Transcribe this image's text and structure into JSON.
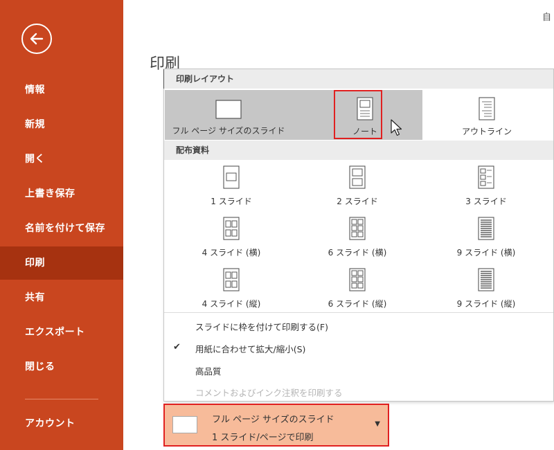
{
  "window": {
    "top_right_text": "自",
    "heading": "印刷"
  },
  "sidebar": {
    "items": [
      {
        "label": "情報"
      },
      {
        "label": "新規"
      },
      {
        "label": "開く"
      },
      {
        "label": "上書き保存"
      },
      {
        "label": "名前を付けて保存"
      },
      {
        "label": "印刷",
        "active": true
      },
      {
        "label": "共有"
      },
      {
        "label": "エクスポート"
      },
      {
        "label": "閉じる"
      },
      {
        "label": "アカウント"
      }
    ]
  },
  "print_layout": {
    "section_label": "印刷レイアウト",
    "options": [
      {
        "label": "フル ページ サイズのスライド",
        "icon": "full-page-slide-icon",
        "state": "selected"
      },
      {
        "label": "ノート",
        "icon": "notes-page-icon",
        "state": "hover"
      },
      {
        "label": "アウトライン",
        "icon": "outline-page-icon",
        "state": "normal"
      }
    ]
  },
  "handouts": {
    "section_label": "配布資料",
    "options": [
      {
        "label": "1 スライド",
        "icon": "handout-1-slide-icon"
      },
      {
        "label": "2 スライド",
        "icon": "handout-2-slide-icon"
      },
      {
        "label": "3 スライド",
        "icon": "handout-3-slide-icon"
      },
      {
        "label": "4 スライド (横)",
        "icon": "handout-4-horizontal-icon"
      },
      {
        "label": "6 スライド (横)",
        "icon": "handout-6-horizontal-icon"
      },
      {
        "label": "9 スライド (横)",
        "icon": "handout-9-horizontal-icon"
      },
      {
        "label": "4 スライド (縦)",
        "icon": "handout-4-vertical-icon"
      },
      {
        "label": "6 スライド (縦)",
        "icon": "handout-6-vertical-icon"
      },
      {
        "label": "9 スライド (縦)",
        "icon": "handout-9-vertical-icon"
      }
    ]
  },
  "menu_options": [
    {
      "label": "スライドに枠を付けて印刷する(F)",
      "checked": false,
      "enabled": true
    },
    {
      "label": "用紙に合わせて拡大/縮小(S)",
      "checked": true,
      "enabled": true
    },
    {
      "label": "高品質",
      "checked": false,
      "enabled": true
    },
    {
      "label": "コメントおよびインク注釈を印刷する",
      "checked": false,
      "enabled": false
    }
  ],
  "selected_setting": {
    "title": "フル ページ サイズのスライド",
    "subtitle": "1 スライド/ページで印刷"
  },
  "colors": {
    "sidebar": "#c9461f",
    "sidebar_active": "#a63210",
    "highlight_border": "#e02020",
    "select_background": "#f7bb9a",
    "selected_band": "#c6c6c6"
  }
}
